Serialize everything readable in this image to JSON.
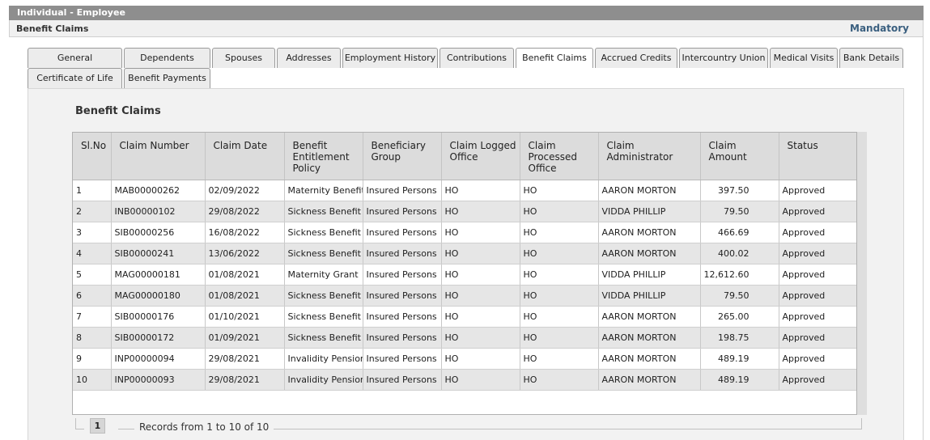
{
  "window": {
    "title": "Individual - Employee"
  },
  "header": {
    "section": "Benefit Claims",
    "mandatory": "Mandatory"
  },
  "tabs": [
    {
      "label": "General"
    },
    {
      "label": "Dependents"
    },
    {
      "label": "Spouses"
    },
    {
      "label": "Addresses"
    },
    {
      "label": "Employment History"
    },
    {
      "label": "Contributions"
    },
    {
      "label": "Benefit Claims",
      "active": true
    },
    {
      "label": "Accrued Credits"
    },
    {
      "label": "Intercountry Union"
    },
    {
      "label": "Medical Visits"
    },
    {
      "label": "Bank Details"
    },
    {
      "label": "Certificate of Life"
    },
    {
      "label": "Benefit Payments"
    }
  ],
  "panel": {
    "title": "Benefit Claims"
  },
  "table": {
    "columns": [
      "Sl.No",
      "Claim Number",
      "Claim Date",
      "Benefit Entitlement Policy",
      "Beneficiary Group",
      "Claim Logged Office",
      "Claim Processed Office",
      "Claim Administrator",
      "Claim Amount",
      "Status"
    ],
    "rows": [
      [
        "1",
        "MAB00000262",
        "02/09/2022",
        "Maternity Benefit",
        "Insured Persons",
        "HO",
        "HO",
        "AARON MORTON",
        "397.50",
        "Approved"
      ],
      [
        "2",
        "INB00000102",
        "29/08/2022",
        "Sickness Benefit",
        "Insured Persons",
        "HO",
        "HO",
        "VIDDA PHILLIP",
        "79.50",
        "Approved"
      ],
      [
        "3",
        "SIB00000256",
        "16/08/2022",
        "Sickness Benefit",
        "Insured Persons",
        "HO",
        "HO",
        "AARON MORTON",
        "466.69",
        "Approved"
      ],
      [
        "4",
        "SIB00000241",
        "13/06/2022",
        "Sickness Benefit",
        "Insured Persons",
        "HO",
        "HO",
        "AARON MORTON",
        "400.02",
        "Approved"
      ],
      [
        "5",
        "MAG00000181",
        "01/08/2021",
        "Maternity Grant",
        "Insured Persons",
        "HO",
        "HO",
        "VIDDA PHILLIP",
        "12,612.60",
        "Approved"
      ],
      [
        "6",
        "MAG00000180",
        "01/08/2021",
        "Sickness Benefit",
        "Insured Persons",
        "HO",
        "HO",
        "VIDDA PHILLIP",
        "79.50",
        "Approved"
      ],
      [
        "7",
        "SIB00000176",
        "01/10/2021",
        "Sickness Benefit",
        "Insured Persons",
        "HO",
        "HO",
        "AARON MORTON",
        "265.00",
        "Approved"
      ],
      [
        "8",
        "SIB00000172",
        "01/09/2021",
        "Sickness Benefit",
        "Insured Persons",
        "HO",
        "HO",
        "AARON MORTON",
        "198.75",
        "Approved"
      ],
      [
        "9",
        "INP00000094",
        "29/08/2021",
        "Invalidity Pension",
        "Insured Persons",
        "HO",
        "HO",
        "AARON MORTON",
        "489.19",
        "Approved"
      ],
      [
        "10",
        "INP00000093",
        "29/08/2021",
        "Invalidity Pension",
        "Insured Persons",
        "HO",
        "HO",
        "AARON MORTON",
        "489.19",
        "Approved"
      ]
    ]
  },
  "pager": {
    "page": "1",
    "records": "Records from 1 to 10 of 10"
  }
}
